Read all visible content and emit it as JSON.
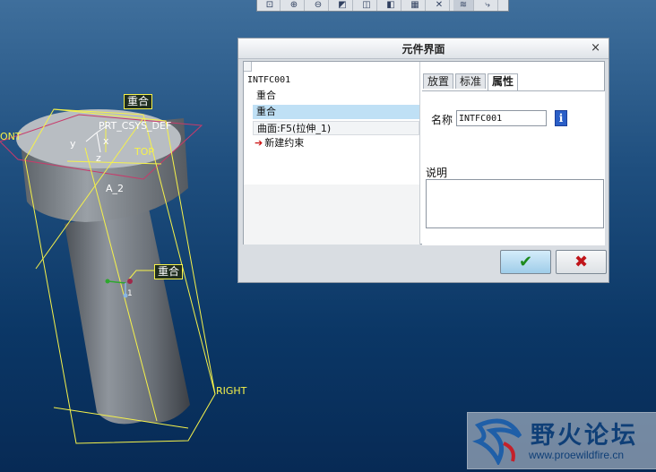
{
  "viewport": {
    "datum_front": "ONT",
    "datum_top": "TOP",
    "datum_right": "RIGHT",
    "csys": "PRT_CSYS_DEF",
    "axis": "A_2",
    "axis_y": "y",
    "axis_x": "x",
    "axis_z": "z",
    "axis_1": "1",
    "tag_top": "重合",
    "tag_mid": "重合"
  },
  "toolbar": {
    "buttons": [
      "zoom-fit-icon",
      "zoom-in-icon",
      "zoom-out-icon",
      "repaint-icon",
      "orient-icon",
      "view-icon",
      "layer-icon",
      "datum-icon",
      "display-icon",
      "csys-icon"
    ]
  },
  "dialog": {
    "title": "元件界面",
    "close": "×",
    "tree": {
      "root": "INTFC001",
      "items": [
        "重合",
        "重合",
        "曲面:F5(拉伸_1)"
      ],
      "new_constraint": "新建约束"
    },
    "tabs": [
      "放置",
      "标准",
      "属性"
    ],
    "name_label": "名称",
    "name_value": "INTFC001",
    "info": "i",
    "desc_label": "说明",
    "ok": "✔",
    "cancel": "✖"
  },
  "watermark": {
    "name": "野火论坛",
    "url": "www.proewildfire.cn"
  },
  "colors": {
    "datum_yellow": "#f6f24a",
    "datum_red": "#c83a6a",
    "selection_blue": "#bfe0f5"
  }
}
